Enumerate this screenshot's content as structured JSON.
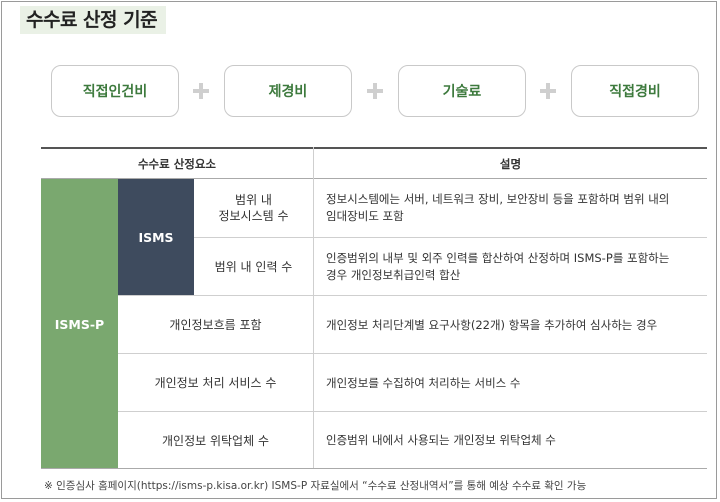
{
  "title": "수수료 산정 기준",
  "components": [
    "직접인건비",
    "제경비",
    "기술료",
    "직접경비"
  ],
  "table": {
    "header_factor": "수수료 산정요소",
    "header_desc": "설명",
    "group_label": "ISMS-P",
    "sub_label": "ISMS",
    "rows": [
      {
        "label": "범위 내\n정보시스템 수",
        "desc": "정보시스템에는 서버, 네트워크 장비, 보안장비 등을 포함하며 범위 내의\n임대장비도 포함"
      },
      {
        "label": "범위 내 인력 수",
        "desc": "인증범위의 내부 및 외주 인력를 합산하여 산정하며 ISMS-P를 포함하는\n경우 개인정보취급인력 합산"
      },
      {
        "label": "개인정보흐름 포함",
        "desc": "개인정보 처리단계별 요구사항(22개) 항목을 추가하여 심사하는 경우"
      },
      {
        "label": "개인정보 처리 서비스 수",
        "desc": "개인정보를 수집하여 처리하는 서비스 수"
      },
      {
        "label": "개인정보 위탁업체 수",
        "desc": "인증범위 내에서 사용되는 개인정보 위탁업체 수"
      }
    ]
  },
  "footnote": "※ 인증심사 홈페이지(https://isms-p.kisa.or.kr) ISMS-P 자료실에서 “수수료 산정내역서”를 통해 예상 수수료 확인 가능",
  "colors": {
    "green": "#7aa86f",
    "navy": "#3e4b5e",
    "accent_text": "#3d7a3d"
  }
}
